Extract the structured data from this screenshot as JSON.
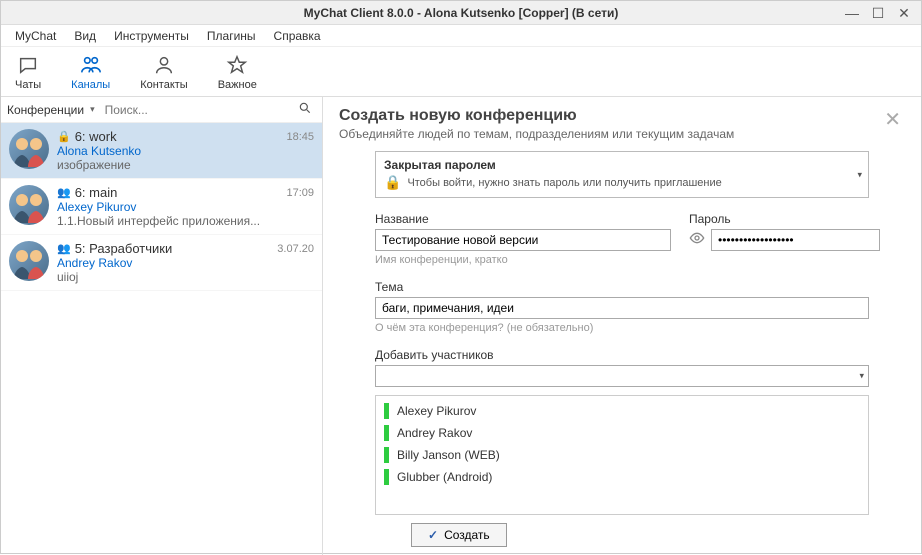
{
  "window": {
    "title": "MyChat Client 8.0.0 - Alona Kutsenko [Copper] (В сети)"
  },
  "menu": [
    "MyChat",
    "Вид",
    "Инструменты",
    "Плагины",
    "Справка"
  ],
  "tools": [
    {
      "label": "Чаты",
      "active": false
    },
    {
      "label": "Каналы",
      "active": true
    },
    {
      "label": "Контакты",
      "active": false
    },
    {
      "label": "Важное",
      "active": false
    }
  ],
  "sidebar": {
    "tab_label": "Конференции",
    "search_placeholder": "Поиск..."
  },
  "conferences": [
    {
      "title": "6: work",
      "locked": true,
      "time": "18:45",
      "user": "Alona Kutsenko",
      "msg": "изображение",
      "selected": true
    },
    {
      "title": "6: main",
      "locked": false,
      "time": "17:09",
      "user": "Alexey Pikurov",
      "msg": "1.1.Новый интерфейс приложения...",
      "selected": false
    },
    {
      "title": "5: Разработчики",
      "locked": false,
      "time": "3.07.20",
      "user": "Andrey Rakov",
      "msg": "uiioj",
      "selected": false
    }
  ],
  "panel": {
    "title": "Создать новую конференцию",
    "subtitle": "Объединяйте людей по темам, подразделениям или текущим задачам",
    "locked_title": "Закрытая паролем",
    "locked_desc": "Чтобы войти, нужно знать пароль или получить приглашение",
    "name_label": "Название",
    "name_value": "Тестирование новой версии",
    "name_hint": "Имя конференции, кратко",
    "pass_label": "Пароль",
    "pass_value": "••••••••••••••••••",
    "topic_label": "Тема",
    "topic_value": "баги, примечания, идеи",
    "topic_hint": "О чём эта конференция? (не обязательно)",
    "add_label": "Добавить участников",
    "create_btn": "Создать"
  },
  "participants": [
    "Alexey Pikurov",
    "Andrey Rakov",
    "Billy Janson (WEB)",
    "Glubber (Android)"
  ]
}
